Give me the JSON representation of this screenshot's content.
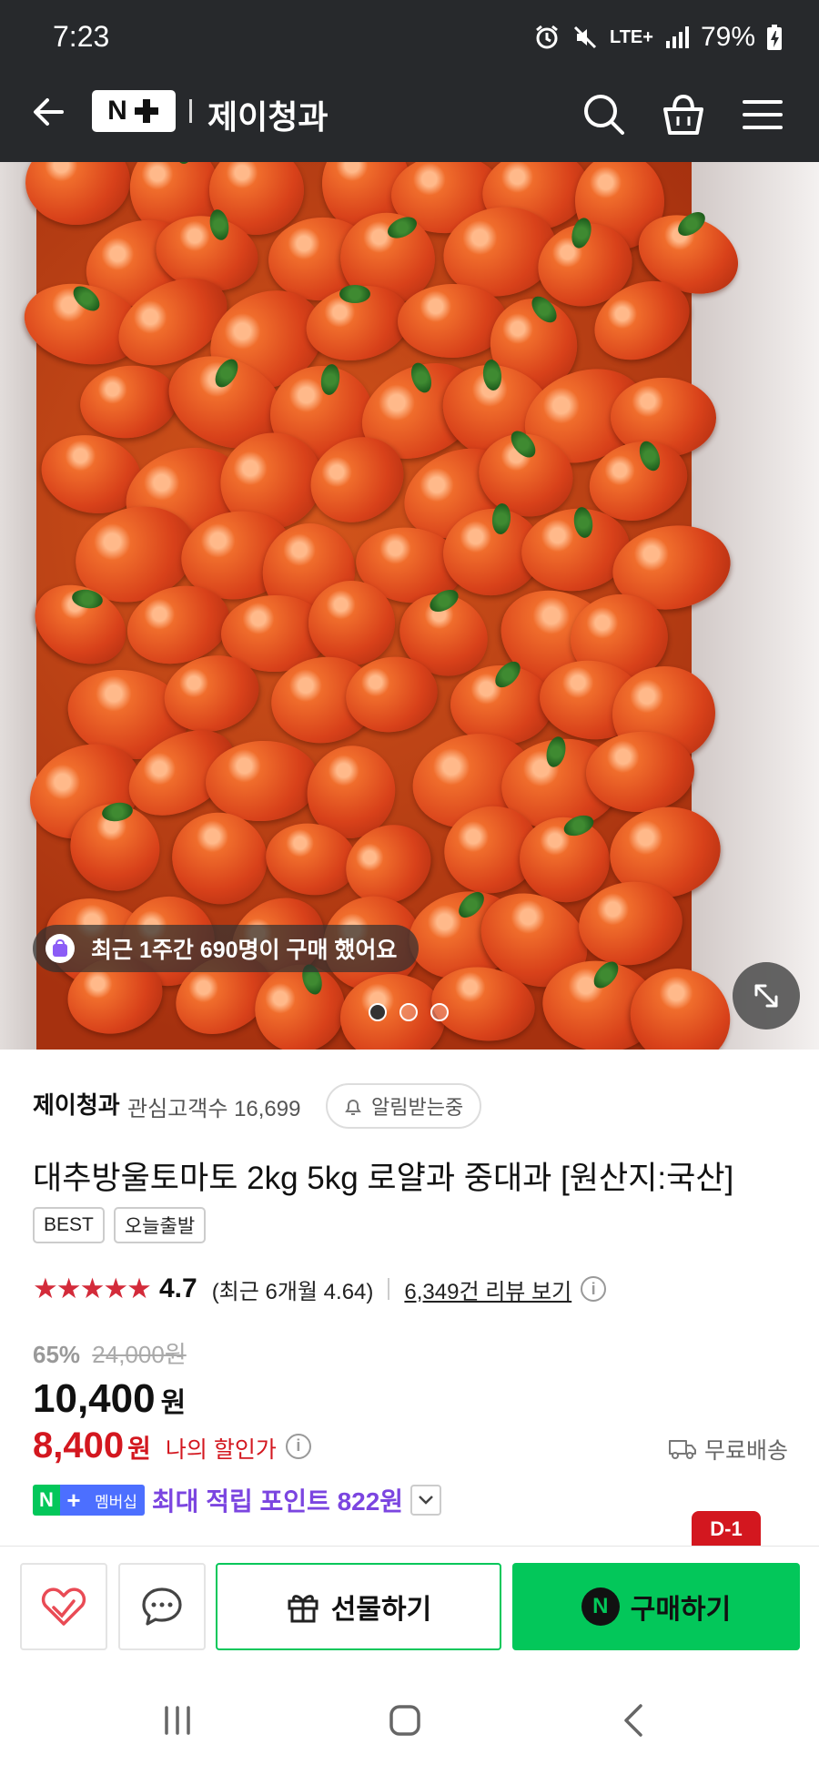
{
  "status_bar": {
    "time": "7:23",
    "network": "LTE+",
    "battery": "79%"
  },
  "app_bar": {
    "logo_text": "N+",
    "store_name": "제이청과"
  },
  "hero": {
    "purchase_notice": "최근 1주간 690명이 구매 했어요",
    "carousel_total": 3,
    "carousel_active": 1
  },
  "seller": {
    "name": "제이청과",
    "fan_count_label": "관심고객수 16,699",
    "alert_label": "알림받는중"
  },
  "product": {
    "title": "대추방울토마토 2kg 5kg 로얄과 중대과 [원산지:국산]",
    "badges": [
      "BEST",
      "오늘출발"
    ]
  },
  "rating": {
    "stars": "★★★★★",
    "score": "4.7",
    "recent": "(최근 6개월 4.64)",
    "review_link": "6,349건 리뷰 보기"
  },
  "price": {
    "discount_rate": "65%",
    "original": "24,000원",
    "sale": "10,400",
    "sale_unit": "원",
    "my_price": "8,400",
    "my_unit": "원",
    "my_price_label": "나의 할인가",
    "shipping": "무료배송"
  },
  "membership": {
    "badge_label": "멤버십",
    "points_text": "최대 적립 포인트 822원"
  },
  "deadline_badge": "D-1",
  "bottom_bar": {
    "gift_label": "선물하기",
    "buy_label": "구매하기",
    "buy_icon_letter": "N"
  },
  "colors": {
    "naver_green": "#03c75a",
    "sale_red": "#d3171f",
    "points_purple": "#7b45e0",
    "header_dark": "#27292c"
  }
}
